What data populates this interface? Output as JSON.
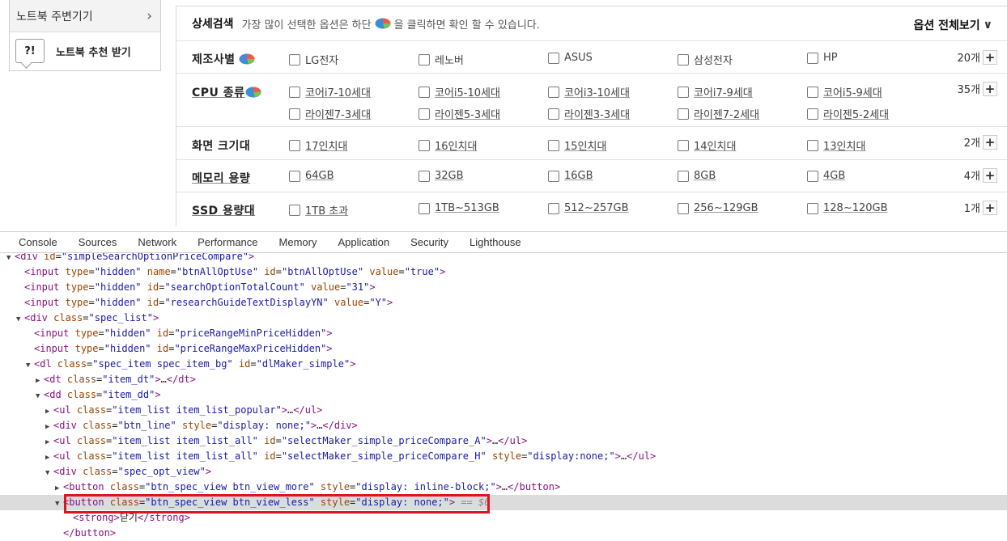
{
  "sidebar": {
    "item1": "노트북 주변기기",
    "item2_icon_text": "?!",
    "item2": "노트북 추천 받기"
  },
  "search": {
    "title": "상세검색",
    "desc_before": "가장 많이 선택한 옵션은 하단",
    "desc_after": "을 클릭하면 확인 할 수 있습니다.",
    "view_all": "옵션 전체보기",
    "rows": [
      {
        "label": "제조사별",
        "options": [
          "LG전자",
          "레노버",
          "ASUS",
          "삼성전자",
          "HP"
        ],
        "count": "20개"
      },
      {
        "label": "CPU 종류",
        "options": [
          "코어i7-10세대",
          "코어i5-10세대",
          "코어i3-10세대",
          "코어i7-9세대",
          "코어i5-9세대",
          "라이젠7-3세대",
          "라이젠5-3세대",
          "라이젠3-3세대",
          "라이젠7-2세대",
          "라이젠5-2세대"
        ],
        "count": "35개"
      },
      {
        "label": "화면 크기대",
        "options": [
          "17인치대",
          "16인치대",
          "15인치대",
          "14인치대",
          "13인치대"
        ],
        "count": "2개"
      },
      {
        "label": "메모리 용량",
        "options": [
          "64GB",
          "32GB",
          "16GB",
          "8GB",
          "4GB"
        ],
        "count": "4개"
      },
      {
        "label": "SSD 용량대",
        "options": [
          "1TB 초과",
          "1TB~513GB",
          "512~257GB",
          "256~129GB",
          "128~120GB"
        ],
        "count": "1개"
      }
    ]
  },
  "devtools": {
    "tabs": [
      "Console",
      "Sources",
      "Network",
      "Performance",
      "Memory",
      "Application",
      "Security",
      "Lighthouse"
    ],
    "lines": [
      "<div id=\"simpleSearchOptionPriceCompare\">",
      "<input type=\"hidden\" name=\"btnAllOptUse\" id=\"btnAllOptUse\" value=\"true\">",
      "<input type=\"hidden\" id=\"searchOptionTotalCount\" value=\"31\">",
      "<input type=\"hidden\" id=\"researchGuideTextDisplayYN\" value=\"Y\">",
      "<div class=\"spec_list\">",
      "<input type=\"hidden\" id=\"priceRangeMinPriceHidden\">",
      "<input type=\"hidden\" id=\"priceRangeMaxPriceHidden\">",
      "<dl class=\"spec_item spec_item_bg\" id=\"dlMaker_simple\">",
      "<dt class=\"item_dt\">…</dt>",
      "<dd class=\"item_dd\">",
      "<ul class=\"item_list item_list_popular\">…</ul>",
      "<div class=\"btn_line\" style=\"display: none;\">…</div>",
      "<ul class=\"item_list item_list_all\" id=\"selectMaker_simple_priceCompare_A\">…</ul>",
      "<ul class=\"item_list item_list_all\" id=\"selectMaker_simple_priceCompare_H\" style=\"display:none;\">…</ul>",
      "<div class=\"spec_opt_view\">",
      "<button class=\"btn_spec_view btn_view_more\" style=\"display: inline-block;\">…</button>",
      "<button class=\"btn_spec_view btn_view_less\" style=\"display: none;\">",
      "<strong>닫기</strong>",
      "</button>"
    ],
    "selected_suffix": " == $0"
  },
  "colors": {
    "highlight_box": "#e0141e",
    "tag": "#881280",
    "attr_name": "#994500",
    "attr_value": "#1a1aa6"
  },
  "icons": [
    "chevron-right-icon",
    "question-bubble-icon",
    "pie-chart-icon",
    "chevron-down-icon",
    "plus-icon",
    "checkbox-icon"
  ]
}
